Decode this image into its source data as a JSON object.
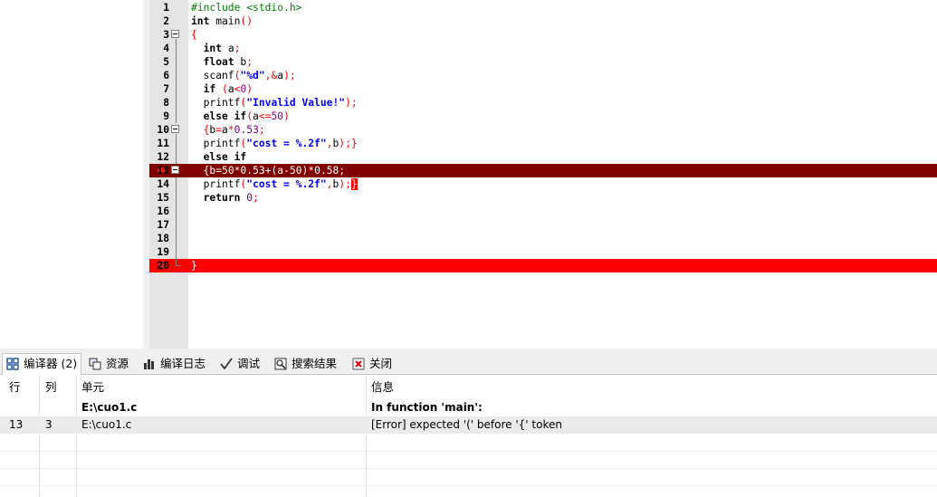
{
  "editor": {
    "lines": [
      {
        "n": "1",
        "tokens": [
          [
            "pp",
            "#include <stdio.h>"
          ]
        ]
      },
      {
        "n": "2",
        "tokens": [
          [
            "kw",
            "int"
          ],
          [
            "id",
            " main"
          ],
          [
            "sym",
            "()"
          ]
        ]
      },
      {
        "n": "3",
        "tokens": [
          [
            "sym",
            "{"
          ]
        ]
      },
      {
        "n": "4",
        "tokens": [
          [
            "id",
            "  "
          ],
          [
            "kw",
            "int"
          ],
          [
            "id",
            " a"
          ],
          [
            "sym",
            ";"
          ]
        ]
      },
      {
        "n": "5",
        "tokens": [
          [
            "id",
            "  "
          ],
          [
            "kw",
            "float"
          ],
          [
            "id",
            " b"
          ],
          [
            "sym",
            ";"
          ]
        ]
      },
      {
        "n": "6",
        "tokens": [
          [
            "id",
            "  scanf"
          ],
          [
            "sym",
            "("
          ],
          [
            "str",
            "\"%d\""
          ],
          [
            "sym",
            ",&"
          ],
          [
            "id",
            "a"
          ],
          [
            "sym",
            ");"
          ]
        ]
      },
      {
        "n": "7",
        "tokens": [
          [
            "id",
            "  "
          ],
          [
            "kw",
            "if"
          ],
          [
            "id",
            " "
          ],
          [
            "sym",
            "("
          ],
          [
            "id",
            "a"
          ],
          [
            "sym",
            "<"
          ],
          [
            "num",
            "0"
          ],
          [
            "sym",
            ")"
          ]
        ]
      },
      {
        "n": "8",
        "tokens": [
          [
            "id",
            "  printf"
          ],
          [
            "sym",
            "("
          ],
          [
            "str",
            "\"Invalid Value!\""
          ],
          [
            "sym",
            ");"
          ]
        ]
      },
      {
        "n": "9",
        "tokens": [
          [
            "id",
            "  "
          ],
          [
            "kw",
            "else if"
          ],
          [
            "sym",
            "("
          ],
          [
            "id",
            "a"
          ],
          [
            "sym",
            "<="
          ],
          [
            "num",
            "50"
          ],
          [
            "sym",
            ")"
          ]
        ]
      },
      {
        "n": "10",
        "tokens": [
          [
            "id",
            "  "
          ],
          [
            "sym",
            "{"
          ],
          [
            "id",
            "b"
          ],
          [
            "sym",
            "="
          ],
          [
            "id",
            "a"
          ],
          [
            "sym",
            "*"
          ],
          [
            "num",
            "0.53"
          ],
          [
            "sym",
            ";"
          ]
        ]
      },
      {
        "n": "11",
        "tokens": [
          [
            "id",
            "  printf"
          ],
          [
            "sym",
            "("
          ],
          [
            "str",
            "\"cost = %.2f\""
          ],
          [
            "sym",
            ","
          ],
          [
            "id",
            "b"
          ],
          [
            "sym",
            ");}"
          ]
        ]
      },
      {
        "n": "12",
        "tokens": [
          [
            "id",
            "  "
          ],
          [
            "kw",
            "else if"
          ]
        ]
      },
      {
        "n": "13",
        "tokens": [
          [
            "id",
            "  "
          ],
          [
            "sym",
            "{"
          ],
          [
            "id",
            "b"
          ],
          [
            "sym",
            "="
          ],
          [
            "num",
            "50"
          ],
          [
            "sym",
            "*"
          ],
          [
            "num",
            "0.53"
          ],
          [
            "sym",
            "+("
          ],
          [
            "id",
            "a"
          ],
          [
            "sym",
            "-"
          ],
          [
            "num",
            "50"
          ],
          [
            "sym",
            ")*"
          ],
          [
            "num",
            "0.58"
          ],
          [
            "sym",
            ";"
          ]
        ]
      },
      {
        "n": "14",
        "tokens": [
          [
            "id",
            "  printf"
          ],
          [
            "sym",
            "("
          ],
          [
            "str",
            "\"cost = %.2f\""
          ],
          [
            "sym",
            ","
          ],
          [
            "id",
            "b"
          ],
          [
            "sym",
            ");"
          ],
          [
            "brace",
            "}"
          ]
        ]
      },
      {
        "n": "15",
        "tokens": [
          [
            "id",
            "  "
          ],
          [
            "kw",
            "return"
          ],
          [
            "id",
            " "
          ],
          [
            "num",
            "0"
          ],
          [
            "sym",
            ";"
          ]
        ]
      },
      {
        "n": "16",
        "tokens": []
      },
      {
        "n": "17",
        "tokens": []
      },
      {
        "n": "18",
        "tokens": []
      },
      {
        "n": "19",
        "tokens": []
      },
      {
        "n": "20",
        "tokens": [
          [
            "sym",
            "}"
          ]
        ]
      }
    ],
    "error_lines": [
      "13",
      "20"
    ],
    "colors": {
      "error_line": "#800000",
      "error_mark": "#ff0000",
      "keyword": "#000000",
      "preprocessor": "#008000",
      "string": "#0000ff",
      "number": "#800080",
      "symbol": "#ff0000"
    }
  },
  "tabs": [
    {
      "label": "编译器 (2)",
      "icon": "compiler-grid-icon",
      "active": true
    },
    {
      "label": "资源",
      "icon": "resources-icon",
      "active": false
    },
    {
      "label": "编译日志",
      "icon": "compile-log-chart-icon",
      "active": false
    },
    {
      "label": "调试",
      "icon": "debug-check-icon",
      "active": false
    },
    {
      "label": "搜索结果",
      "icon": "search-results-icon",
      "active": false
    },
    {
      "label": "关闭",
      "icon": "close-icon",
      "active": false
    }
  ],
  "messages": {
    "headers": {
      "row": "行",
      "col": "列",
      "unit": "单元",
      "info": "信息"
    },
    "rows": [
      {
        "row": "",
        "col": "",
        "unit": "E:\\cuo1.c",
        "info": "In function 'main':",
        "bold": true,
        "selected": false
      },
      {
        "row": "13",
        "col": "3",
        "unit": "E:\\cuo1.c",
        "info": "[Error] expected '(' before '{' token",
        "bold": false,
        "selected": true
      }
    ]
  }
}
